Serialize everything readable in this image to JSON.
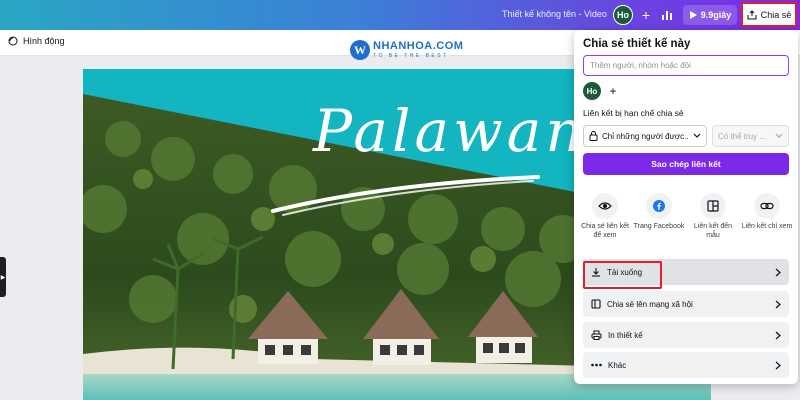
{
  "topbar": {
    "doc_title": "Thiết kế không tên - Video",
    "avatar_initials": "Ho",
    "play_label": "9.9giây",
    "share_label": "Chia sẻ"
  },
  "subbar": {
    "animation_label": "Hình động"
  },
  "logo": {
    "main": "NHANHOA.COM",
    "sub": "TO BE THE BEST",
    "letter": "W"
  },
  "design": {
    "script_text": "Palawan"
  },
  "share_panel": {
    "title": "Chia sẻ thiết kế này",
    "invite_placeholder": "Thêm người, nhóm hoặc đội",
    "avatar_initials": "Ho",
    "link_label": "Liên kết bị hạn chế chia sẻ",
    "access_value": "Chỉ những người được...",
    "permission_value": "Có thể truy ...",
    "copy_link_label": "Sao chép liên kết",
    "options": [
      {
        "icon": "eye-icon",
        "label": "Chia sẻ liên kết để xem"
      },
      {
        "icon": "facebook-icon",
        "label": "Trang Facebook"
      },
      {
        "icon": "template-icon",
        "label": "Liên kết đến mẫu"
      },
      {
        "icon": "link-icon",
        "label": "Liên kết chỉ xem"
      }
    ],
    "rows": [
      {
        "icon": "download-icon",
        "label": "Tải xuống"
      },
      {
        "icon": "social-share-icon",
        "label": "Chia sẻ lên mạng xã hội"
      },
      {
        "icon": "print-icon",
        "label": "In thiết kế"
      },
      {
        "icon": "more-icon",
        "label": "Khác"
      }
    ]
  },
  "colors": {
    "accent": "#7d2ae8",
    "highlight_border": "#e0202a",
    "teal": "#13b5c0"
  }
}
